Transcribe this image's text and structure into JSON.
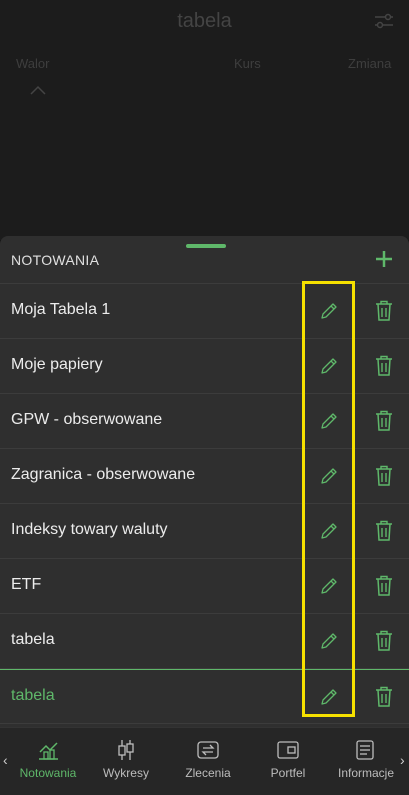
{
  "background": {
    "title": "tabela",
    "columns": [
      "Walor",
      "Kurs",
      "Zmiana"
    ]
  },
  "sheet": {
    "title": "NOTOWANIA",
    "add_icon": "plus-icon",
    "items": [
      {
        "label": "Moja Tabela 1"
      },
      {
        "label": "Moje papiery"
      },
      {
        "label": "GPW - obserwowane"
      },
      {
        "label": "Zagranica - obserwowane"
      },
      {
        "label": "Indeksy towary waluty"
      },
      {
        "label": "ETF"
      },
      {
        "label": "tabela"
      },
      {
        "label": "tabela",
        "selected": true
      }
    ]
  },
  "nav": {
    "items": [
      {
        "label": "Notowania",
        "icon": "chart-icon",
        "active": true
      },
      {
        "label": "Wykresy",
        "icon": "candlestick-icon"
      },
      {
        "label": "Zlecenia",
        "icon": "exchange-icon"
      },
      {
        "label": "Portfel",
        "icon": "wallet-icon"
      },
      {
        "label": "Informacje",
        "icon": "news-icon"
      }
    ]
  },
  "colors": {
    "accent": "#5fb86a",
    "highlight": "#f5e000",
    "sheet_bg": "#2f2f2f"
  }
}
